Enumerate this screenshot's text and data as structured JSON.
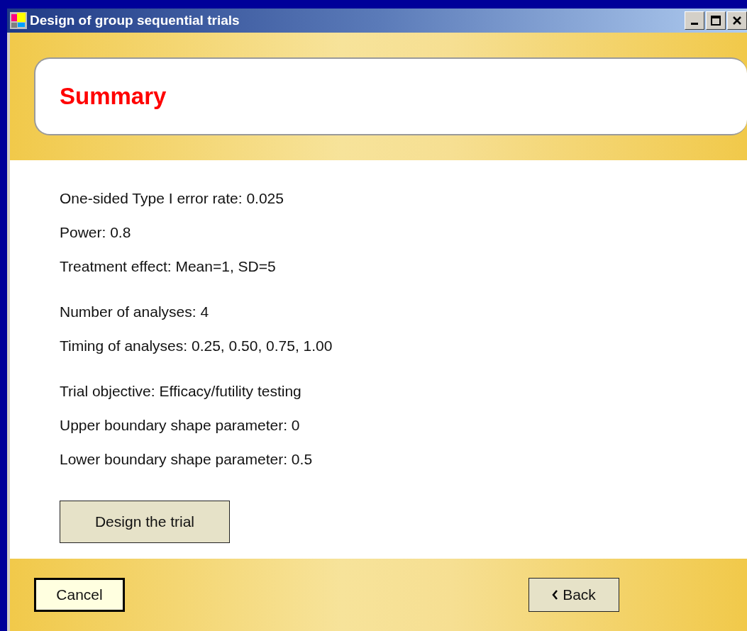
{
  "window": {
    "title": "Design of group sequential trials"
  },
  "header": {
    "title": "Summary"
  },
  "summary_groups": [
    {
      "lines": [
        "One-sided Type I error rate: 0.025",
        "Power: 0.8",
        "Treatment effect: Mean=1, SD=5"
      ]
    },
    {
      "lines": [
        "Number of analyses: 4",
        "Timing of analyses: 0.25, 0.50, 0.75, 1.00"
      ]
    },
    {
      "lines": [
        "Trial objective: Efficacy/futility testing",
        "Upper boundary shape parameter: 0",
        "Lower boundary shape parameter: 0.5"
      ]
    }
  ],
  "action_button": "Design the trial",
  "footer_buttons": [
    {
      "label": "Cancel",
      "kind": "cancel",
      "default": true
    },
    {
      "label": "Back",
      "kind": "back",
      "default": false
    }
  ]
}
